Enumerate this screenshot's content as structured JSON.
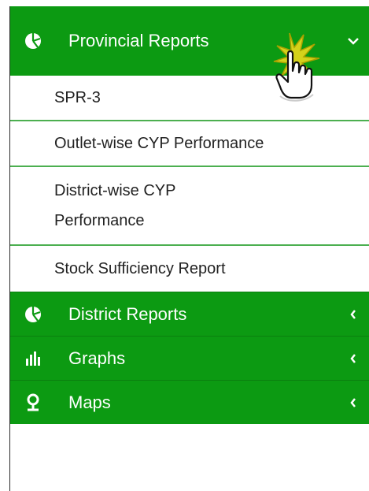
{
  "sidebar": {
    "provincial": {
      "label": "Provincial Reports",
      "icon": "pie-chart-icon",
      "expanded": true,
      "items": [
        {
          "label": "SPR-3"
        },
        {
          "label": "Outlet-wise CYP Performance"
        },
        {
          "label": "District-wise CYP Performance"
        },
        {
          "label": "Stock Sufficiency Report"
        }
      ]
    },
    "district": {
      "label": "District Reports",
      "icon": "pie-chart-icon",
      "expanded": false
    },
    "graphs": {
      "label": "Graphs",
      "icon": "bar-chart-icon",
      "expanded": false
    },
    "maps": {
      "label": "Maps",
      "icon": "map-pin-icon",
      "expanded": false
    }
  },
  "colors": {
    "menu_green": "#0c9a12",
    "divider_green": "#4caf50"
  }
}
